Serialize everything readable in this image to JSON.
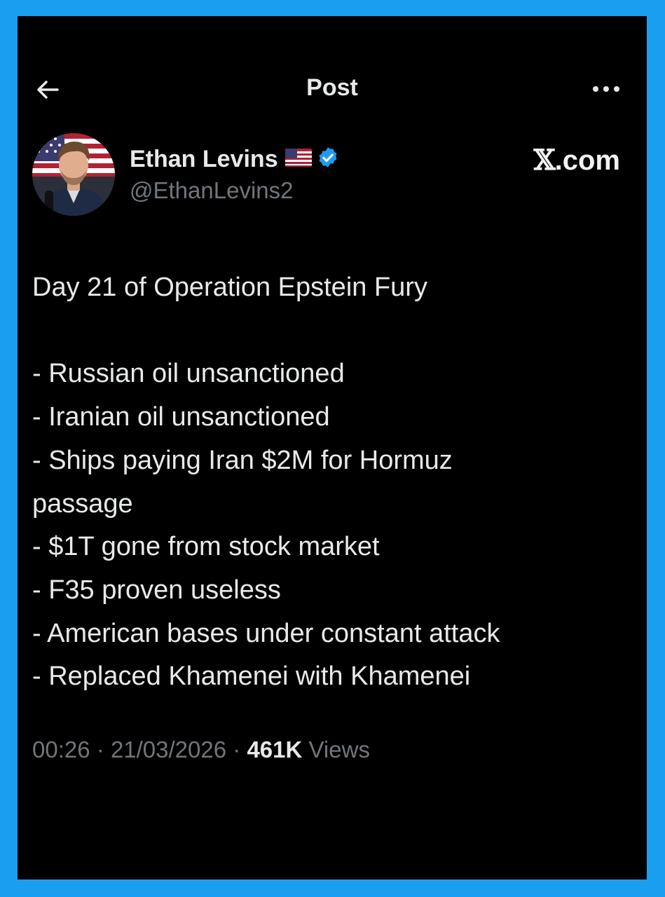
{
  "header": {
    "title": "Post"
  },
  "author": {
    "name": "Ethan Levins",
    "handle": "@EthanLevins2",
    "flag_icon": "us-flag-icon",
    "verified_icon": "verified-badge-icon",
    "verified_color": "#1d9bf0"
  },
  "watermark": {
    "x": "𝕏",
    "domain": ".com"
  },
  "post": {
    "lines": [
      "Day 21 of Operation Epstein Fury",
      "",
      "- Russian oil unsanctioned",
      "- Iranian oil unsanctioned",
      "- Ships paying Iran $2M for Hormuz",
      "passage",
      "- $1T gone from stock market",
      "- F35 proven useless",
      "- American bases under constant attack",
      "- Replaced Khamenei with Khamenei"
    ]
  },
  "meta": {
    "time": "00:26",
    "separator": "·",
    "date": "21/03/2026",
    "views_count": "461K",
    "views_label": "Views"
  },
  "colors": {
    "frame": "#1a9ff0",
    "background": "#000000",
    "text_primary": "#e7e9ea",
    "text_secondary": "#71767b"
  }
}
